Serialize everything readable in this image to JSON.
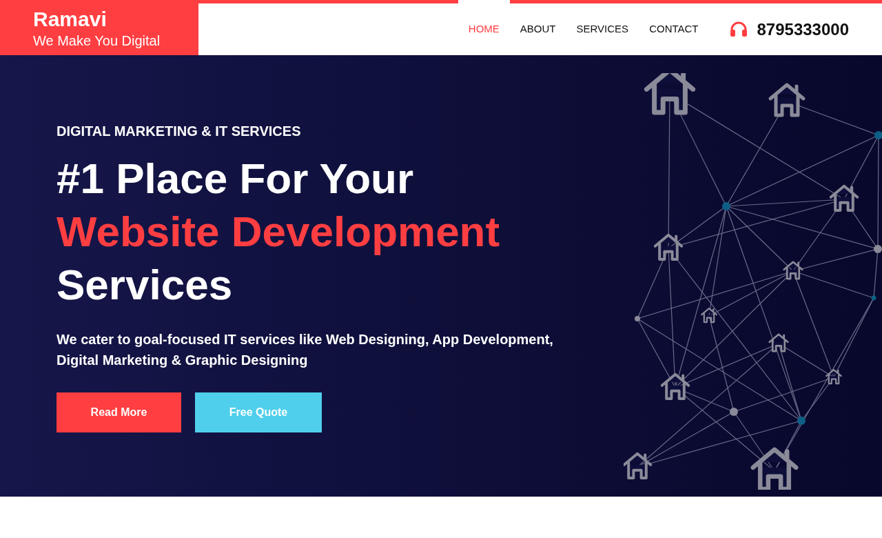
{
  "brand": {
    "name": "Ramavi",
    "tagline": "We Make You Digital"
  },
  "nav": [
    {
      "label": "HOME",
      "selected": true
    },
    {
      "label": "ABOUT",
      "selected": false
    },
    {
      "label": "SERVICES",
      "selected": false
    },
    {
      "label": "CONTACT",
      "selected": false
    }
  ],
  "phone": "8795333000",
  "hero": {
    "eyebrow": "DIGITAL MARKETING & IT SERVICES",
    "headline_1": "#1 Place For Your",
    "headline_highlight": "Website Development",
    "headline_2": "Services",
    "description": "We cater to goal-focused IT services like Web Designing, App Development, Digital Marketing & Graphic Designing",
    "buttons": [
      {
        "label": "Read More",
        "kind": "primary"
      },
      {
        "label": "Free Quote",
        "kind": "secondary"
      }
    ]
  }
}
